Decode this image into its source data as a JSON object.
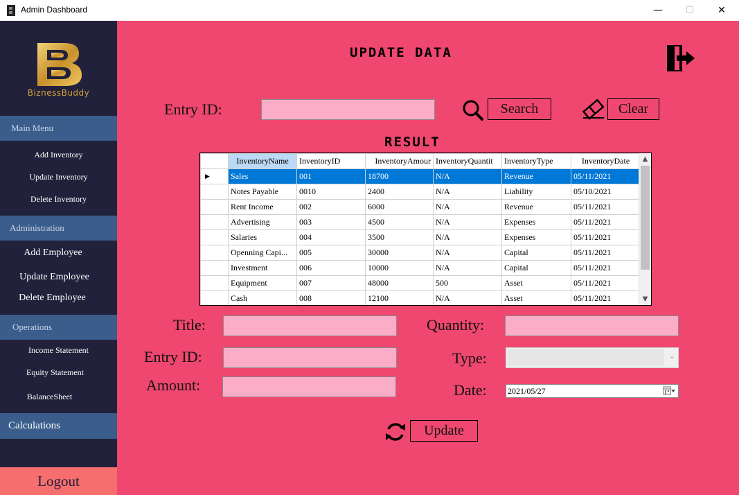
{
  "window": {
    "title": "Admin Dashboard",
    "minimize": "—",
    "maximize": "☐",
    "close": "✕"
  },
  "sidebar": {
    "brand": "BiznessBuddy",
    "main_menu": {
      "label": "Main Menu",
      "items": [
        "Add Inventory",
        "Update Inventory",
        "Delete Inventory"
      ]
    },
    "administration": {
      "label": "Administration",
      "items": [
        "Add Employee",
        "Update Employee",
        "Delete Employee"
      ]
    },
    "operations": {
      "label": "Operations",
      "items": [
        "Income Statement",
        "Equity Statement",
        "BalanceSheet"
      ]
    },
    "calculations": "Calculations",
    "logout": "Logout"
  },
  "main": {
    "heading": "UPDATE DATA",
    "search": {
      "entry_label": "Entry ID:",
      "entry_value": "",
      "search_label": "Search",
      "clear_label": "Clear"
    },
    "result_heading": "RESULT",
    "grid": {
      "columns": [
        "InventoryName",
        "InventoryID",
        "InventoryAmour",
        "InventoryQuantit",
        "InventoryType",
        "InventoryDate"
      ],
      "rows": [
        [
          "Sales",
          "001",
          "18700",
          "N/A",
          "Revenue",
          "05/11/2021"
        ],
        [
          "Notes Payable",
          "0010",
          "2400",
          "N/A",
          "Liability",
          "05/10/2021"
        ],
        [
          "Rent Income",
          "002",
          "6000",
          "N/A",
          "Revenue",
          "05/11/2021"
        ],
        [
          "Advertising",
          "003",
          "4500",
          "N/A",
          "Expenses",
          "05/11/2021"
        ],
        [
          "Salaries",
          "004",
          "3500",
          "N/A",
          "Expenses",
          "05/11/2021"
        ],
        [
          "Openning Capi...",
          "005",
          "30000",
          "N/A",
          "Capital",
          "05/11/2021"
        ],
        [
          "Investment",
          "006",
          "10000",
          "N/A",
          "Capital",
          "05/11/2021"
        ],
        [
          "Equipment",
          "007",
          "48000",
          "500",
          "Asset",
          "05/11/2021"
        ],
        [
          "Cash",
          "008",
          "12100",
          "N/A",
          "Asset",
          "05/11/2021"
        ]
      ],
      "row_indicator": "▶"
    },
    "form": {
      "title_label": "Title:",
      "title_value": "",
      "entry_label": "Entry ID:",
      "entry_value": "",
      "amount_label": "Amount:",
      "amount_value": "",
      "quantity_label": "Quantity:",
      "quantity_value": "",
      "type_label": "Type:",
      "type_value": "",
      "date_label": "Date:",
      "date_value": "2021/05/27"
    },
    "update_label": "Update"
  },
  "colors": {
    "sidebar": "#21213b",
    "section": "#3a5d8c",
    "main": "#ef476f",
    "field": "#fbadc8",
    "logout": "#f76e6e",
    "gold": "#d4a437",
    "selection": "#0078d7"
  }
}
